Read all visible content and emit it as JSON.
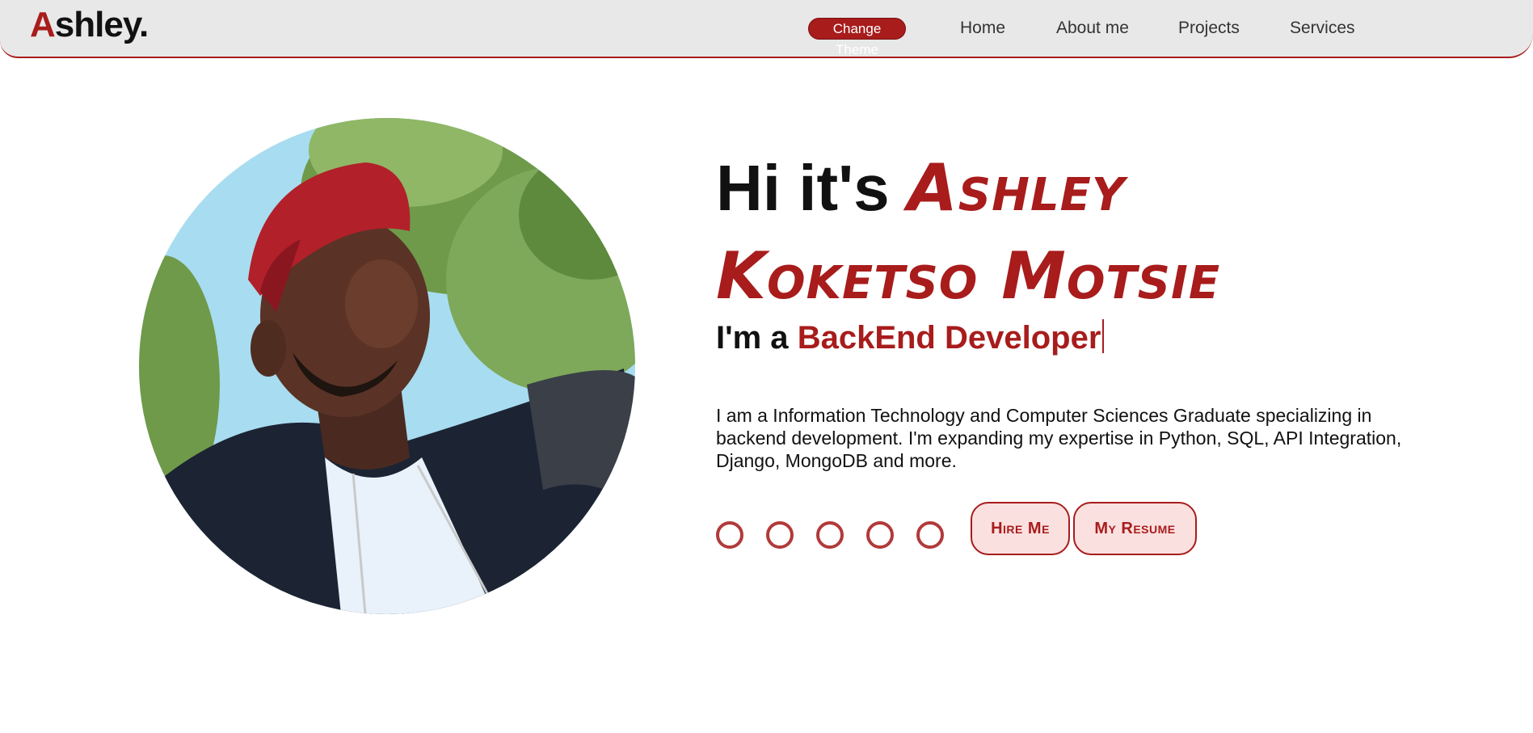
{
  "brand": {
    "first_letter": "A",
    "rest": "shley."
  },
  "nav": {
    "theme_button": "Change Theme",
    "links": [
      "Home",
      "About me",
      "Projects",
      "Services"
    ]
  },
  "hero": {
    "greeting": "Hi it's",
    "name_line1": "Ashley",
    "name_line2": "Koketso Motsie",
    "role_prefix": "I'm a",
    "role": "BackEnd Developer",
    "description": "I am a Information Technology and Computer Sciences Graduate specializing in backend development. I'm expanding my expertise in Python, SQL, API Integration, Django, MongoDB and more.",
    "hire_button": "Hire Me",
    "resume_button": "My Resume"
  },
  "colors": {
    "accent": "#a81c1c",
    "nav_bg": "#e8e8e8"
  }
}
